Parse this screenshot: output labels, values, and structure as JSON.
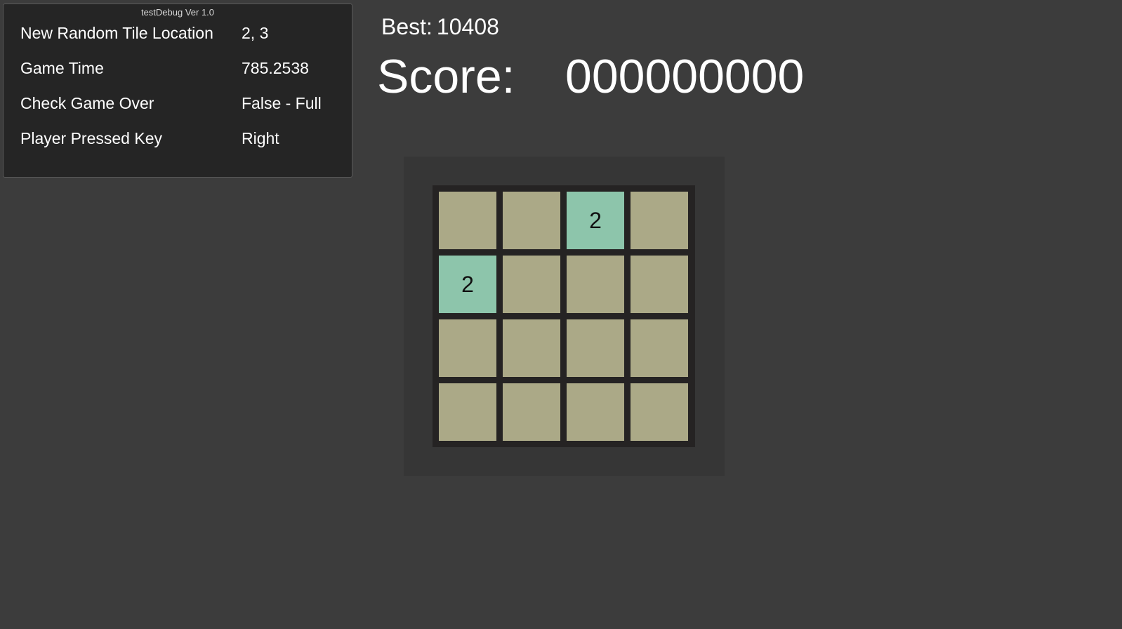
{
  "debug": {
    "title": "testDebug Ver 1.0",
    "rows": [
      {
        "label": "New Random Tile Location",
        "value": "2, 3"
      },
      {
        "label": "Game Time",
        "value": "785.2538"
      },
      {
        "label": "Check Game Over",
        "value": "False - Full"
      },
      {
        "label": "Player Pressed Key",
        "value": "Right"
      }
    ]
  },
  "best": {
    "label": "Best:",
    "value": "10408"
  },
  "score": {
    "label": "Score:",
    "value": "000000000"
  },
  "board": {
    "tiles": [
      [
        "",
        "",
        "2",
        ""
      ],
      [
        "2",
        "",
        "",
        ""
      ],
      [
        "",
        "",
        "",
        ""
      ],
      [
        "",
        "",
        "",
        ""
      ]
    ]
  },
  "colors": {
    "background": "#3c3c3c",
    "empty_tile": "#aba987",
    "tile_2": "#8dc5ab",
    "board_frame": "#252323"
  }
}
